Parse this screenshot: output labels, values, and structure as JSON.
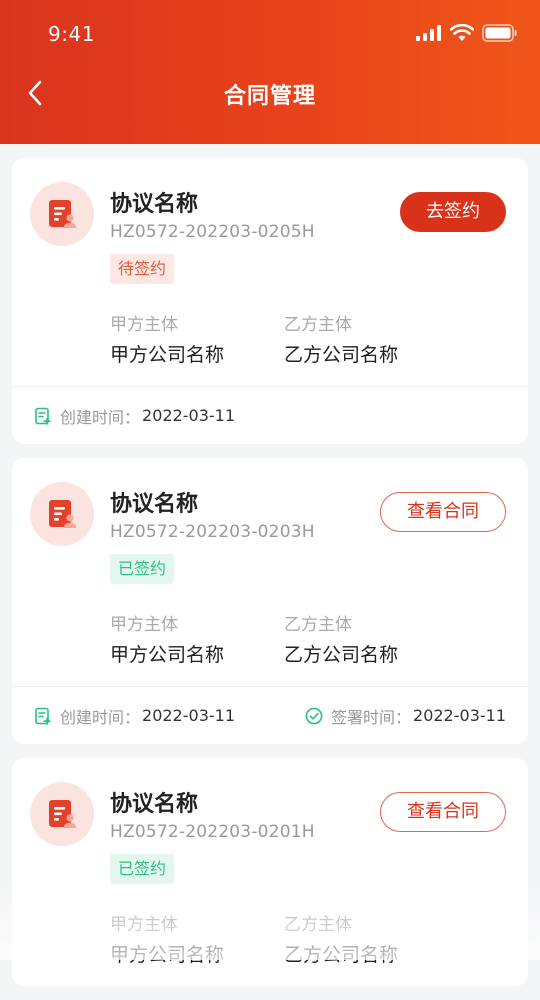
{
  "status_bar": {
    "time": "9:41"
  },
  "nav": {
    "title": "合同管理"
  },
  "colors": {
    "brand": "#d9321b",
    "signed": "#2cbf84",
    "pending": "#e25a3e"
  },
  "contracts": [
    {
      "title": "协议名称",
      "code": "HZ0572-202203-0205H",
      "status": "待签约",
      "status_type": "pending",
      "action": "去签约",
      "party_a_label": "甲方主体",
      "party_a": "甲方公司名称",
      "party_b_label": "乙方主体",
      "party_b": "乙方公司名称",
      "created_label": "创建时间：",
      "created": "2022-03-11"
    },
    {
      "title": "协议名称",
      "code": "HZ0572-202203-0203H",
      "status": "已签约",
      "status_type": "signed",
      "action": "查看合同",
      "party_a_label": "甲方主体",
      "party_a": "甲方公司名称",
      "party_b_label": "乙方主体",
      "party_b": "乙方公司名称",
      "created_label": "创建时间：",
      "created": "2022-03-11",
      "signed_label": "签署时间：",
      "signed": "2022-03-11"
    },
    {
      "title": "协议名称",
      "code": "HZ0572-202203-0201H",
      "status": "已签约",
      "status_type": "signed",
      "action": "查看合同",
      "party_a_label": "甲方主体",
      "party_a": "甲方公司名称",
      "party_b_label": "乙方主体",
      "party_b": "乙方公司名称"
    }
  ]
}
